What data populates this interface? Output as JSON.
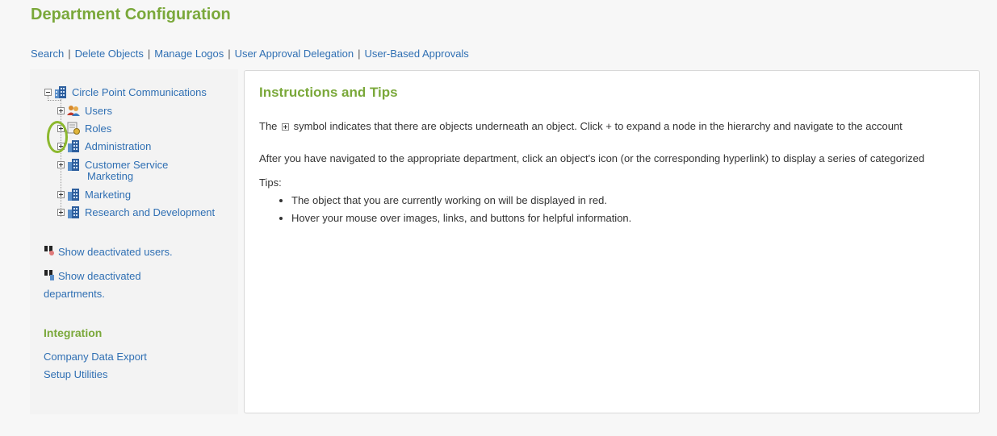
{
  "page": {
    "title": "Department Configuration"
  },
  "top_links": [
    {
      "label": "Search"
    },
    {
      "label": "Delete Objects"
    },
    {
      "label": "Manage Logos"
    },
    {
      "label": "User Approval Delegation"
    },
    {
      "label": "User-Based Approvals"
    }
  ],
  "tree": {
    "root": {
      "label": "Circle Point Communications",
      "icon": "building-icon",
      "expanded": true
    },
    "children": [
      {
        "label": "Users",
        "icon": "users-icon"
      },
      {
        "label": "Roles",
        "icon": "roles-icon"
      },
      {
        "label": "Administration",
        "icon": "building-icon"
      },
      {
        "label": "Customer Service",
        "icon": "building-icon"
      },
      {
        "label": "Marketing",
        "icon": "building-icon"
      },
      {
        "label": "Marketing",
        "icon": "building-icon"
      },
      {
        "label": "Research and Development",
        "icon": "building-icon"
      }
    ]
  },
  "sidebar": {
    "show_deactivated_users": "Show deactivated users.",
    "show_deactivated_departments_line1": "Show deactivated",
    "show_deactivated_departments_line2": "departments.",
    "integration_heading": "Integration",
    "integration_links": [
      "Company Data Export",
      "Setup Utilities"
    ]
  },
  "main": {
    "title": "Instructions and Tips",
    "para1_before": "The",
    "para1_after": "symbol indicates that there are objects underneath an object. Click + to expand a node in the hierarchy and navigate to the account",
    "para2": "After you have navigated to the appropriate department, click an object's icon (or the corresponding hyperlink) to display a series of categorized",
    "tips_label": "Tips:",
    "tips": [
      "The object that you are currently working on will be displayed in red.",
      "Hover your mouse over images, links, and buttons for helpful information."
    ]
  },
  "colors": {
    "accent_green": "#7aa83a",
    "link_blue": "#2f6fb3",
    "highlight_ring": "#8cb82e"
  }
}
